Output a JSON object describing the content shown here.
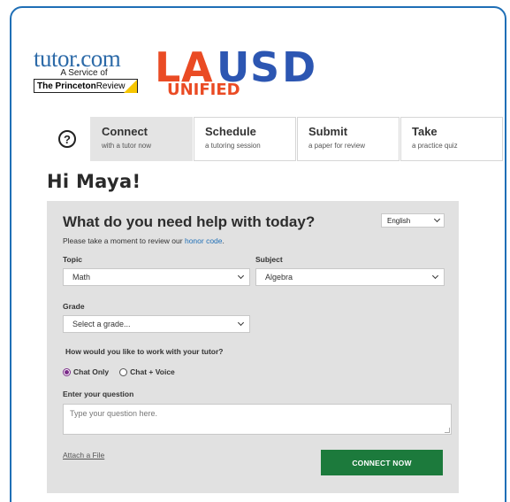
{
  "brand": {
    "tutor_word": "tutor.com",
    "tutor_service": "A Service of",
    "princeton_bold": "The Princeton",
    "princeton_rest": " Review",
    "lausd_letters": [
      "L",
      "A",
      "U",
      "S",
      "D"
    ],
    "lausd_unified": "UNIFIED",
    "colors": {
      "lausd_orange": "#ea4b24",
      "lausd_blue": "#2c56b2",
      "tutor_blue": "#2c6aa8",
      "princeton_yellow": "#f7c600"
    }
  },
  "nav": {
    "help_symbol": "?",
    "tabs": [
      {
        "title": "Connect",
        "subtitle": "with a tutor now",
        "active": true
      },
      {
        "title": "Schedule",
        "subtitle": "a tutoring session",
        "active": false
      },
      {
        "title": "Submit",
        "subtitle": "a paper for review",
        "active": false
      },
      {
        "title": "Take",
        "subtitle": "a practice quiz",
        "active": false
      }
    ]
  },
  "greeting": "Hi Maya!",
  "form": {
    "heading": "What do you need help with today?",
    "intro_text": "Please take a moment to review our ",
    "honor_link": "honor code",
    "intro_end": ".",
    "language": "English",
    "topic_label": "Topic",
    "topic_value": "Math",
    "subject_label": "Subject",
    "subject_value": "Algebra",
    "grade_label": "Grade",
    "grade_value": "Select a grade...",
    "work_question": "How would you like to work with your tutor?",
    "mode_options": [
      {
        "label": "Chat Only",
        "selected": true
      },
      {
        "label": "Chat + Voice",
        "selected": false
      }
    ],
    "question_label": "Enter your question",
    "question_placeholder": "Type your question here.",
    "attach_label": "Attach a File",
    "connect_button": "CONNECT NOW",
    "colors": {
      "accent_green": "#1c7a3c",
      "radio_purple": "#7a2b89",
      "link_blue": "#1f6fb6"
    }
  }
}
